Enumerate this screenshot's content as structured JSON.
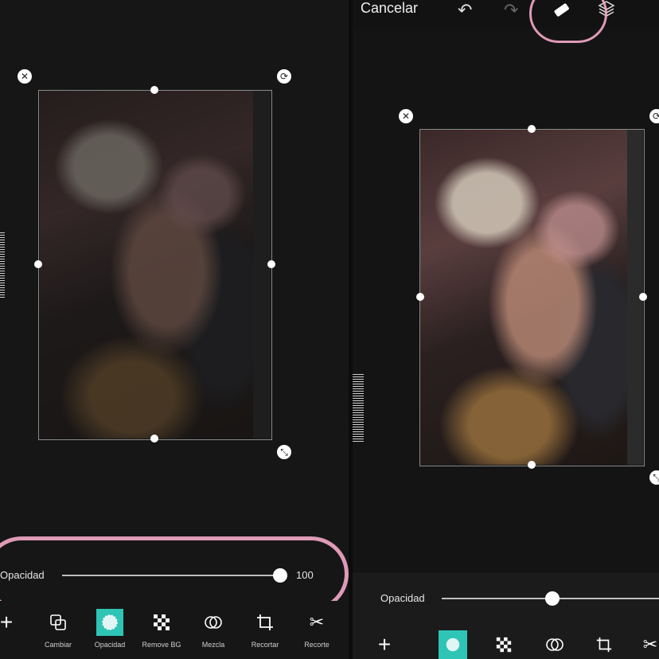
{
  "left": {
    "slider": {
      "label": "Opacidad",
      "value": "100"
    },
    "tools": [
      {
        "icon": "plus-icon",
        "label": ""
      },
      {
        "icon": "swap-icon",
        "label": "Cambiar"
      },
      {
        "icon": "opacity-icon",
        "label": "Opacidad"
      },
      {
        "icon": "checker-icon",
        "label": "Remove BG"
      },
      {
        "icon": "blend-icon",
        "label": "Mezcla"
      },
      {
        "icon": "crop-icon",
        "label": "Recortar"
      },
      {
        "icon": "scissors-icon",
        "label": "Recorte"
      }
    ]
  },
  "right": {
    "topbar": {
      "cancel": "Cancelar"
    },
    "slider": {
      "label": "Opacidad"
    }
  },
  "colors": {
    "accent": "#2ec4b6",
    "annotation": "#f4a8c8"
  }
}
